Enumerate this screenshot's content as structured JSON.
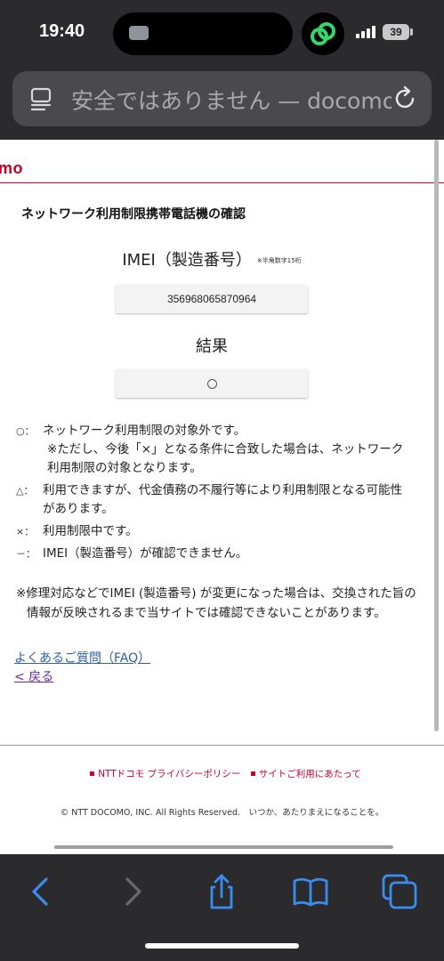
{
  "status_bar": {
    "time": "19:40",
    "battery": "39"
  },
  "address_bar": {
    "text": "安全ではありません — docomo.jp"
  },
  "page": {
    "brand": "mo",
    "title": "ネットワーク利用制限携帯電話機の確認",
    "imei_label": "IMEI（製造番号）",
    "imei_note": "※半角数字15桁",
    "imei_value": "356968065870964",
    "result_label": "結果",
    "result_value": "○",
    "legend": [
      {
        "symbol": "○：",
        "text": "ネットワーク利用制限の対象外です。",
        "sub": "※ただし、今後「×」となる条件に合致した場合は、ネットワーク利用制限の対象となります。"
      },
      {
        "symbol": "△：",
        "text": "利用できますが、代金債務の不履行等により利用制限となる可能性があります。"
      },
      {
        "symbol": "×：",
        "text": "利用制限中です。"
      },
      {
        "symbol": "－：",
        "text": "IMEI（製造番号）が確認できません。"
      }
    ],
    "notice": "※修理対応などでIMEI (製造番号) が変更になった場合は、交換された旨の情報が反映されるまで当サイトでは確認できないことがあります。",
    "faq_link": "よくあるご質問（FAQ）",
    "back_link": "< 戻る"
  },
  "footer": {
    "privacy_link": "NTTドコモ プライバシーポリシー",
    "terms_link": "サイトご利用にあたって",
    "copyright": "© NTT DOCOMO, INC. All Rights Reserved.　いつか、あたりまえになることを。"
  },
  "colors": {
    "brand_red": "#cc0033",
    "link_blue": "#2e5fa0",
    "visited_purple": "#6b2a9a",
    "ios_blue": "#3a8cf0"
  }
}
